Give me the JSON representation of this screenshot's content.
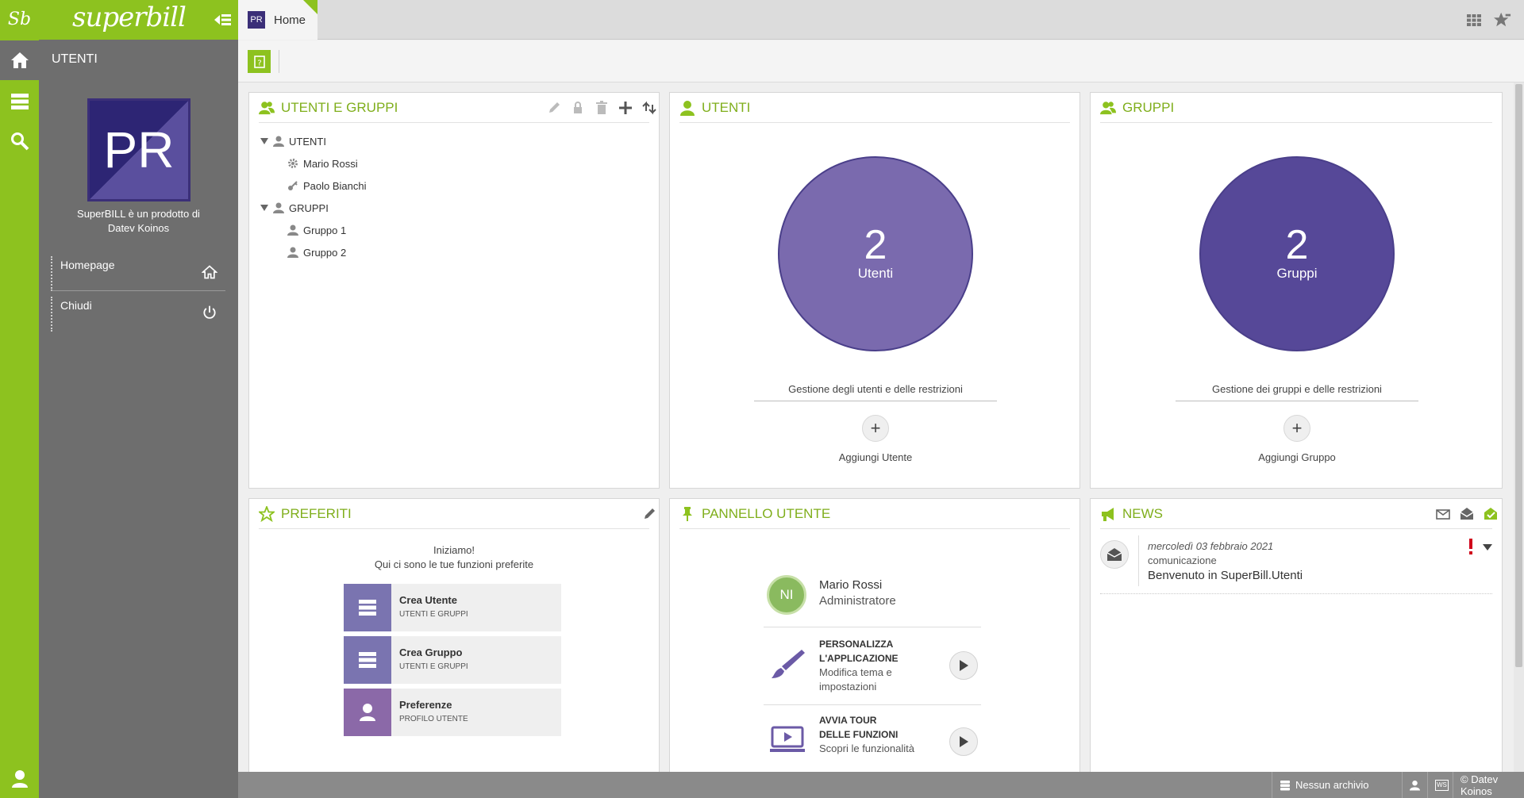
{
  "rail": {
    "logo": "Sb"
  },
  "sidebar": {
    "brand": "superbill",
    "title": "UTENTI",
    "avatar_initials": "PR",
    "product_line1": "SuperBILL è un prodotto di",
    "product_line2": "Datev Koinos",
    "links": [
      {
        "label": "Homepage",
        "icon": "home-icon"
      },
      {
        "label": "Chiudi",
        "icon": "power-icon"
      }
    ]
  },
  "tabs": [
    {
      "badge": "PR",
      "label": "Home"
    }
  ],
  "panels": {
    "users_groups": {
      "title": "UTENTI E GRUPPI",
      "tree": [
        {
          "label": "UTENTI",
          "children": [
            {
              "label": "Mario Rossi",
              "icon": "gear-icon"
            },
            {
              "label": "Paolo Bianchi",
              "icon": "key-icon"
            }
          ]
        },
        {
          "label": "GRUPPI",
          "children": [
            {
              "label": "Gruppo 1",
              "icon": "user-icon"
            },
            {
              "label": "Gruppo 2",
              "icon": "user-icon"
            }
          ]
        }
      ]
    },
    "utenti": {
      "title": "UTENTI",
      "count": "2",
      "count_label": "Utenti",
      "description": "Gestione degli utenti e delle restrizioni",
      "add_label": "Aggiungi Utente",
      "circle_color": "#7a6aae"
    },
    "gruppi": {
      "title": "GRUPPI",
      "count": "2",
      "count_label": "Gruppi",
      "description": "Gestione dei gruppi e delle restrizioni",
      "add_label": "Aggiungi Gruppo",
      "circle_color": "#564898"
    },
    "preferiti": {
      "title": "PREFERITI",
      "intro1": "Iniziamo!",
      "intro2": "Qui ci sono le tue funzioni preferite",
      "items": [
        {
          "title": "Crea Utente",
          "subtitle": "UTENTI E GRUPPI",
          "color": "#7a74b0",
          "icon": "list-icon"
        },
        {
          "title": "Crea Gruppo",
          "subtitle": "UTENTI E GRUPPI",
          "color": "#7a74b0",
          "icon": "list-icon"
        },
        {
          "title": "Preferenze",
          "subtitle": "PROFILO UTENTE",
          "color": "#8b69a8",
          "icon": "user-icon"
        }
      ]
    },
    "pannello": {
      "title": "PANNELLO UTENTE",
      "user_initials": "NI",
      "user_name": "Mario Rossi",
      "user_role": "Administratore",
      "actions": [
        {
          "title1": "PERSONALIZZA",
          "title2": "L'APPLICAZIONE",
          "sub1": "Modifica tema e",
          "sub2": "impostazioni",
          "icon": "brush-icon"
        },
        {
          "title1": "AVVIA TOUR",
          "title2": "DELLE FUNZIONI",
          "sub1": "Scopri le funzionalità",
          "sub2": "",
          "icon": "screen-play-icon"
        }
      ]
    },
    "news": {
      "title": "NEWS",
      "items": [
        {
          "date": "mercoledì 03 febbraio 2021",
          "type": "comunicazione",
          "title": "Benvenuto in SuperBill.Utenti"
        }
      ]
    }
  },
  "status": {
    "archive": "Nessun archivio",
    "ws": "WS",
    "copyright": "© Datev Koinos"
  },
  "colors": {
    "accent": "#8dc21f",
    "title_green": "#7fae1b",
    "sidebar": "#6e6e6e",
    "brand_purple": "#3b2f78"
  }
}
